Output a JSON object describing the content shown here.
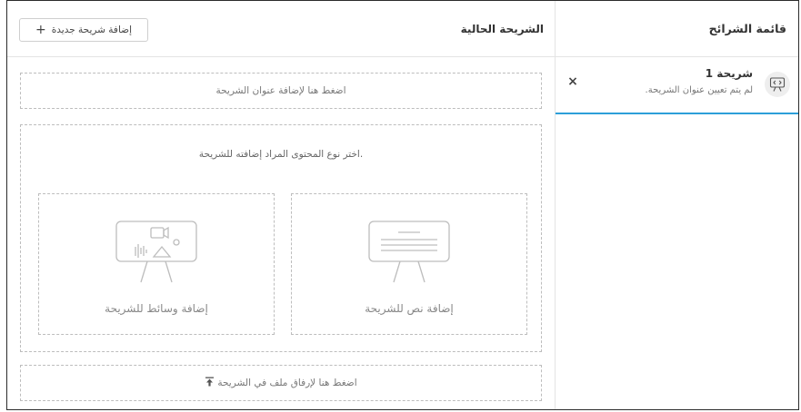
{
  "sidebar": {
    "title": "قائمة الشرائح",
    "slides": [
      {
        "title": "شريحة 1",
        "subtitle": "لم يتم تعيين عنوان الشريحة."
      }
    ],
    "close_symbol": "×"
  },
  "main": {
    "title": "الشريحة الحالية",
    "add_button": {
      "icon": "+",
      "label": "إضافة شريحة جديدة"
    },
    "title_zone": "اضغط هنا لإضافة عنوان الشريحة",
    "content_prompt": ".اختر نوع المحتوى المراد إضافته للشريحة",
    "options": {
      "text": "إضافة نص للشريحة",
      "media": "إضافة وسائط للشريحة"
    },
    "attach_zone": "اضغط هنا لإرفاق ملف في الشريحة",
    "attach_icon": "upload-icon"
  },
  "icons": [
    "presentation-icon",
    "close-icon",
    "plus-icon",
    "slide-text-icon",
    "slide-media-icon",
    "upload-icon"
  ]
}
